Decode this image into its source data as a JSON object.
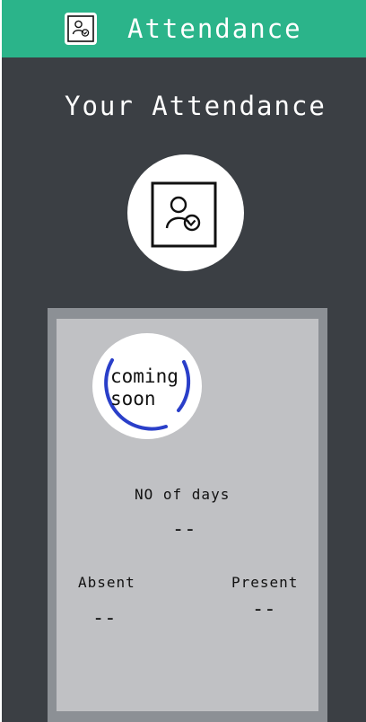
{
  "header": {
    "title": "Attendance",
    "icon": "attendance-icon"
  },
  "main": {
    "heading": "Your Attendance",
    "profile_icon": "user-check-icon"
  },
  "card": {
    "badge": {
      "line1": "coming",
      "line2": "soon"
    },
    "days_label": "NO of days",
    "days_value": "--",
    "absent_label": "Absent",
    "absent_value": "--",
    "present_label": "Present",
    "present_value": "--"
  },
  "colors": {
    "header_bg": "#2bb48a",
    "body_bg": "#3b3f44",
    "card_border": "#8c9095",
    "card_bg": "#c0c1c4",
    "ring": "#2a3fc9"
  }
}
